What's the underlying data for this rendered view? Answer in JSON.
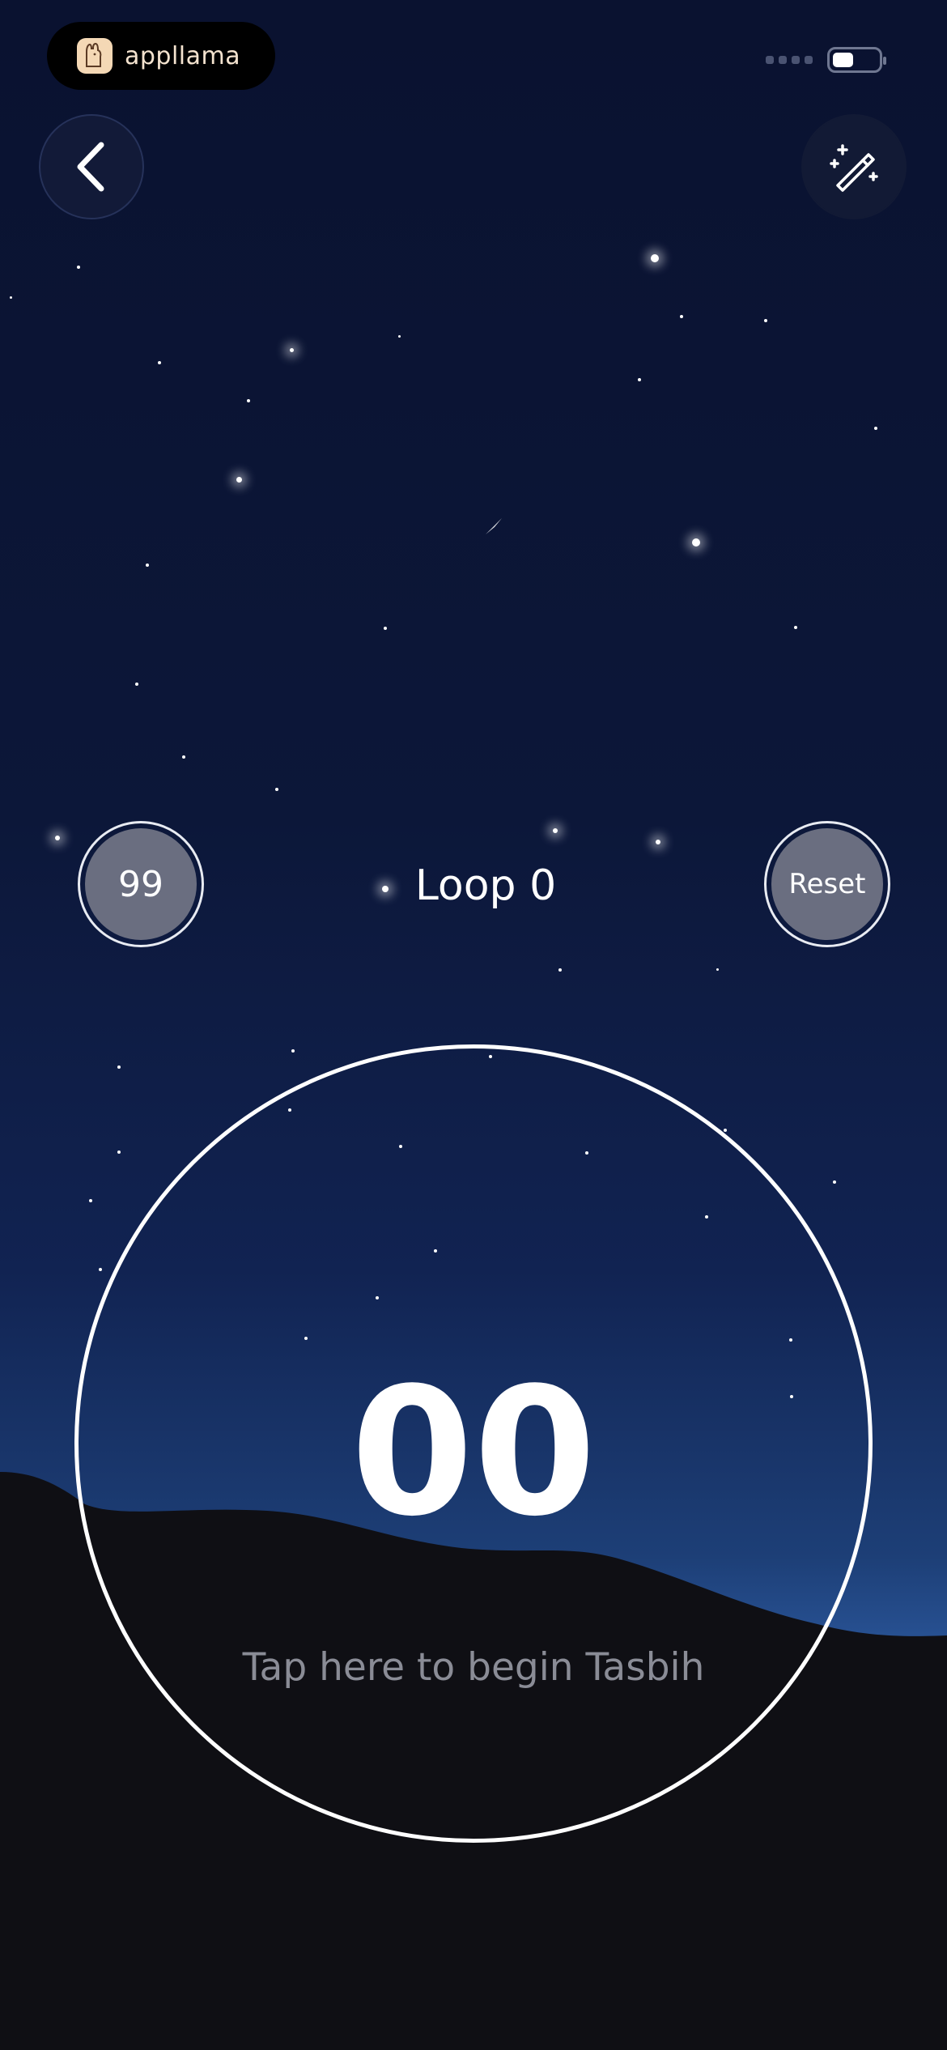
{
  "status_bar": {
    "brand_text": "appllama",
    "battery_level": 0.45
  },
  "header": {
    "back_icon": "chevron-left-icon",
    "magic_icon": "magic-wand-icon"
  },
  "controls": {
    "target_count": "99",
    "loop_label": "Loop 0",
    "reset_label": "Reset"
  },
  "counter": {
    "value": "00",
    "hint": "Tap here to begin Tasbih"
  },
  "colors": {
    "sky_top": "#0a1230",
    "horizon": "#2d5aa0",
    "ground": "#0f0f14",
    "ring": "#ffffff",
    "button_fill": "#6a6e80",
    "brand_text": "#f4e3cf"
  }
}
